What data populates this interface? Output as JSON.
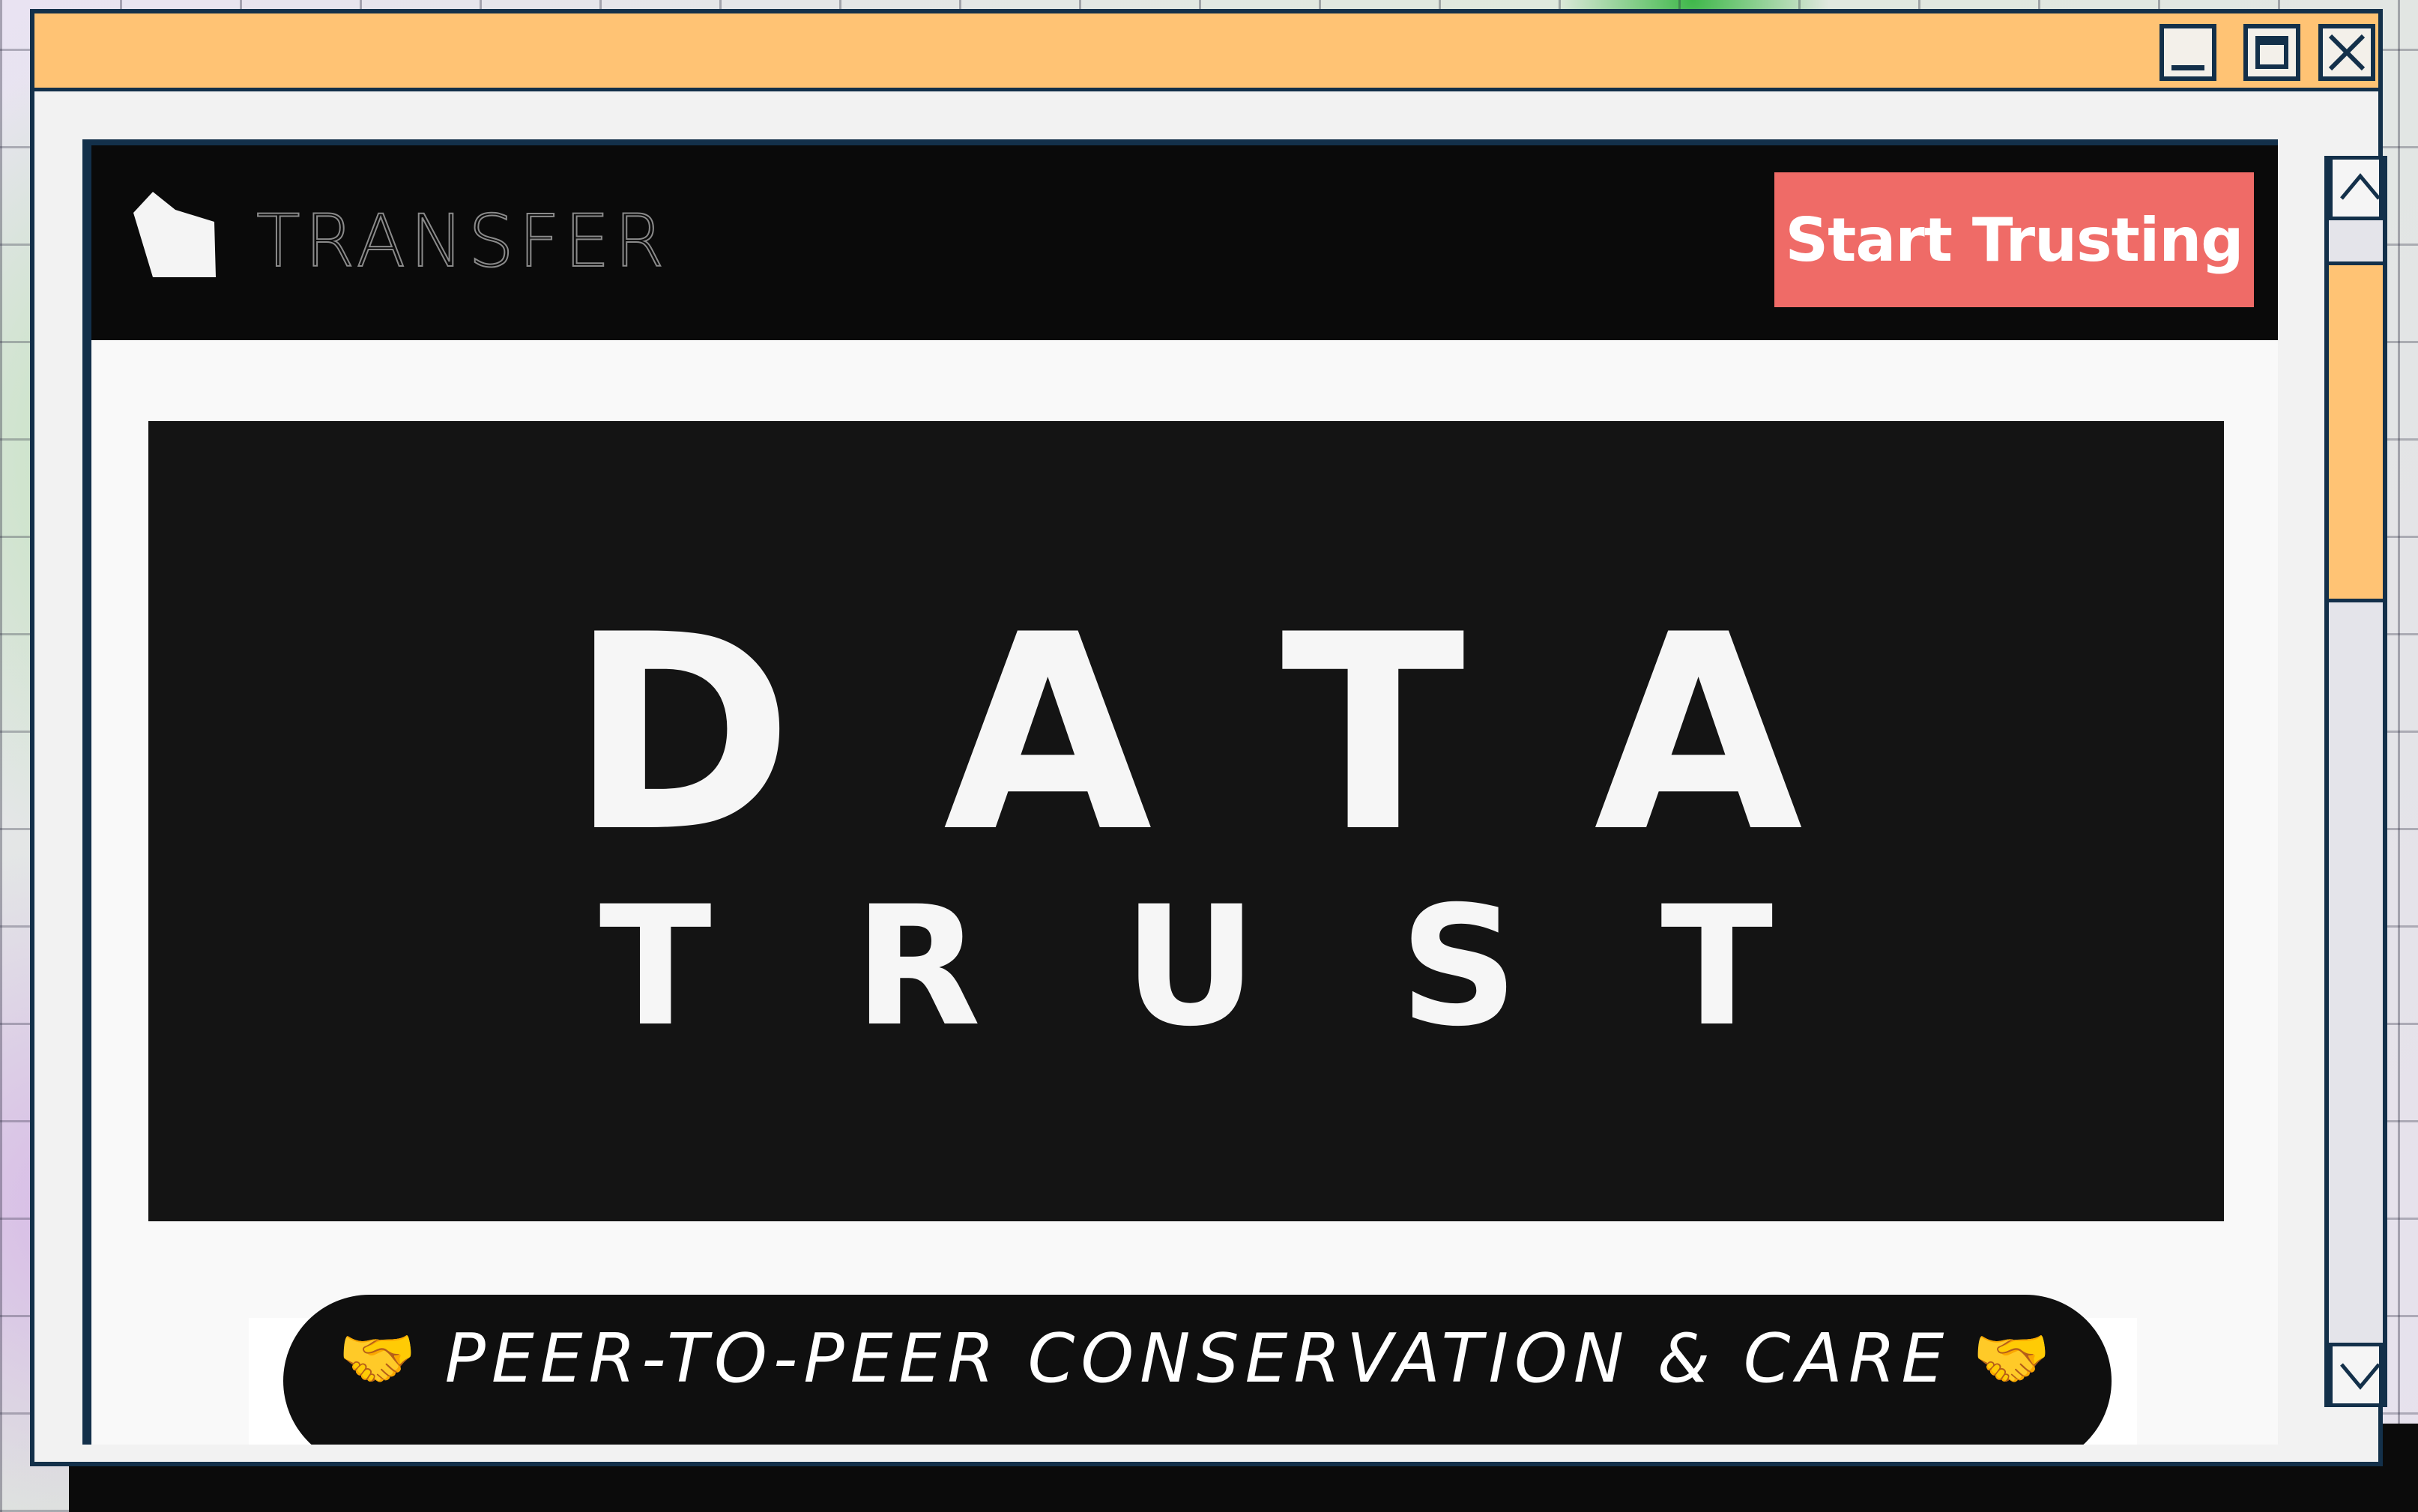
{
  "window": {
    "controls": {
      "minimize_icon": "minimize-icon",
      "maximize_icon": "maximize-icon",
      "close_icon": "close-icon"
    },
    "titlebar_color": "#ffc374",
    "border_color": "#13304a"
  },
  "site": {
    "logo_text": "TRANSFER",
    "cta_label": "Start Trusting",
    "cta_color": "#ef6b67",
    "hero": {
      "line1": "DATA",
      "line2": "TRUST"
    },
    "tagline": {
      "left_icon": "🤝",
      "text": "PEER-TO-PEER CONSERVATION & CARE",
      "right_icon": "🤝"
    }
  },
  "scrollbar": {
    "up_icon": "chevron-up-icon",
    "down_icon": "chevron-down-icon",
    "thumb_color": "#ffc374"
  }
}
